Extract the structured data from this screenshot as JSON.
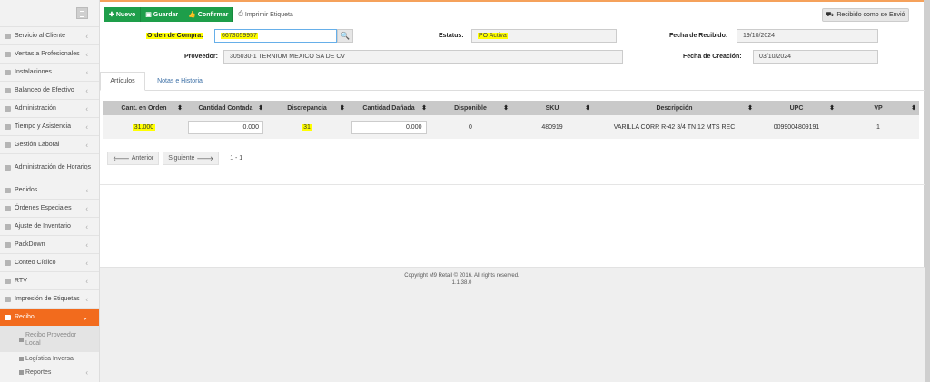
{
  "sidebar": {
    "items": [
      {
        "label": "Servicio al Cliente",
        "icon": "user-icon"
      },
      {
        "label": "Ventas a Profesionales",
        "icon": "user-icon"
      },
      {
        "label": "Instalaciones",
        "icon": "wrench-icon"
      },
      {
        "label": "Balanceo de Efectivo",
        "icon": "money-icon"
      },
      {
        "label": "Administración",
        "icon": "wrench-icon"
      },
      {
        "label": "Tiempo y Asistencia",
        "icon": "clock-icon"
      },
      {
        "label": "Gestión Laboral",
        "icon": "users-icon"
      },
      {
        "label": "Administración de Horarios",
        "icon": "calendar-icon"
      },
      {
        "label": "Pedidos",
        "icon": "document-icon"
      },
      {
        "label": "Órdenes Especiales",
        "icon": "document-icon"
      },
      {
        "label": "Ajuste de Inventario",
        "icon": "adjust-icon"
      },
      {
        "label": "PackDown",
        "icon": "box-icon"
      },
      {
        "label": "Conteo Cíclico",
        "icon": "barcode-icon"
      },
      {
        "label": "RTV",
        "icon": "truck-icon"
      },
      {
        "label": "Impresión de Etiquetas",
        "icon": "print-icon"
      },
      {
        "label": "Recibo",
        "icon": "truck-icon"
      }
    ],
    "subitems": [
      {
        "label": "Recibo Proveedor Local",
        "icon": "truck-icon"
      },
      {
        "label": "Logística Inversa",
        "icon": "truck-icon"
      },
      {
        "label": "Reportes",
        "icon": "truck-icon"
      }
    ],
    "chevron_right": "‹",
    "chevron_down": "⌄"
  },
  "toolbar": {
    "new_label": "Nuevo",
    "save_label": "Guardar",
    "confirm_label": "Confirmar",
    "print_label": "Imprimir Etiqueta",
    "received_label": "Recibido como se Envió"
  },
  "form": {
    "po_label": "Orden de Compra:",
    "po_value": "6673059957",
    "status_label": "Estatus:",
    "status_value": "PO Activa",
    "received_date_label": "Fecha de Recibido:",
    "received_date_value": "19/10/2024",
    "supplier_label": "Proveedor:",
    "supplier_value": "305030-1 TERNIUM MEXICO SA DE CV",
    "created_date_label": "Fecha de Creación:",
    "created_date_value": "03/10/2024"
  },
  "tabs": [
    {
      "label": "Artículos"
    },
    {
      "label": "Notas e Historia"
    }
  ],
  "table": {
    "headers": [
      "Cant. en Orden",
      "Cantidad Contada",
      "Discrepancia",
      "Cantidad Dañada",
      "Disponible",
      "SKU",
      "Descripción",
      "UPC",
      "VP"
    ],
    "row": {
      "qty_ordered": "31.000",
      "qty_counted": "0.000",
      "discrepancy": "31",
      "qty_damaged": "0.000",
      "available": "0",
      "sku": "480919",
      "description": "VARILLA CORR R-42 3/4 TN 12 MTS REC",
      "upc": "0099004809191",
      "vp": "1"
    },
    "sort_glyph": "⬍"
  },
  "pager": {
    "prev_label": "Anterior",
    "next_label": "Siguiente",
    "info": "1 - 1"
  },
  "footer": {
    "copyright": "Copyright M9 Retail © 2016. All rights reserved.",
    "version": "1.1.38.0"
  },
  "colors": {
    "accent_orange": "#f26b1d",
    "button_green": "#1e9e4a",
    "highlight_yellow": "#ffff00"
  }
}
